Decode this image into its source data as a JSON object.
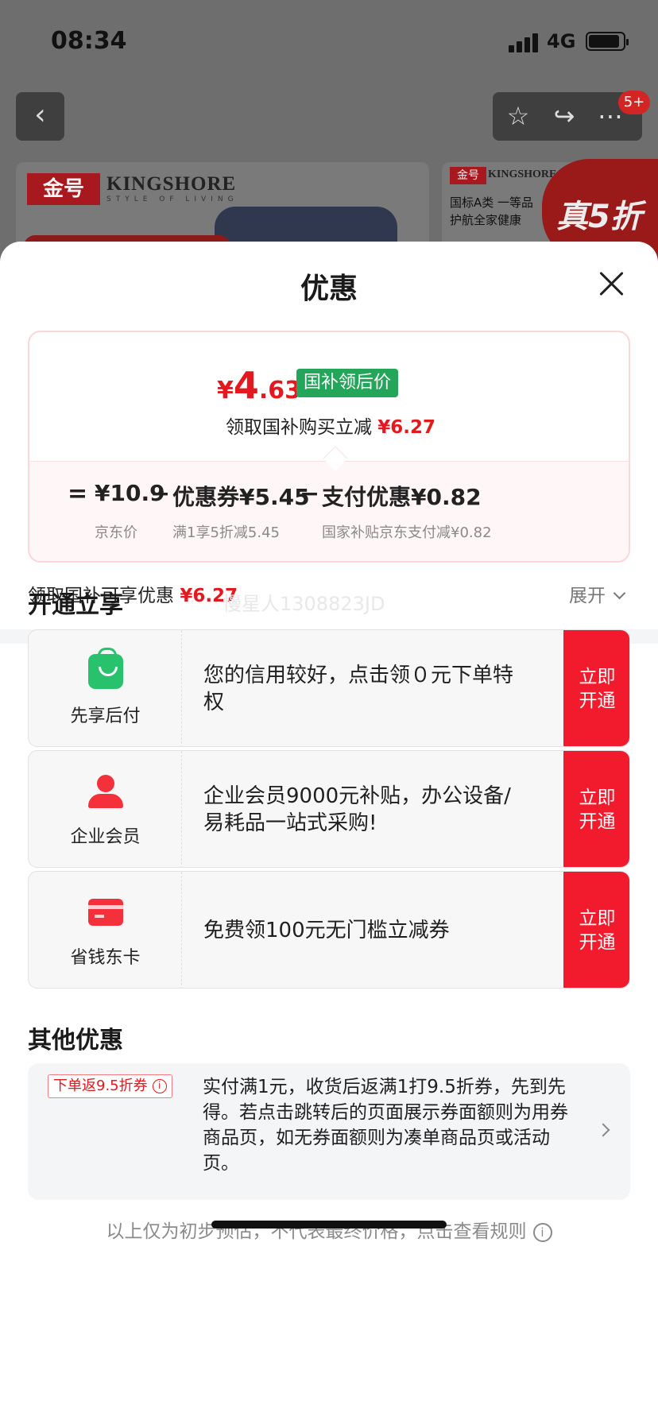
{
  "status_bar": {
    "time": "08:34",
    "network": "4G"
  },
  "background_page": {
    "notification_badge": "5+",
    "banner_left": {
      "brand_cn": "金号",
      "brand_en": "KINGSHORE",
      "brand_tagline": "STYLE OF LIVING"
    },
    "banner_right": {
      "brand_cn": "金号",
      "brand_en": "KINGSHORE",
      "line1": "国标A类 一等品",
      "line2": "护航全家健康",
      "sale": "真5折"
    }
  },
  "sheet": {
    "title": "优惠",
    "price_card": {
      "currency": "¥",
      "final_int": "4",
      "final_dec": ".63",
      "tag": "国补领后价",
      "save_text": "领取国补购买立减",
      "save_amount": "¥6.27",
      "calc": {
        "eq": "=",
        "item1_value": "¥10.9",
        "item1_sub": "京东价",
        "minus": "−",
        "item2_value": "优惠券¥5.45",
        "item2_sub": "满1享5折减5.45",
        "item3_value": "支付优惠¥0.82",
        "item3_sub": "国家补贴京东支付减¥0.82"
      }
    },
    "summary": {
      "text": "领取国补可享优惠",
      "amount": "¥6.27",
      "expand_label": "展开"
    },
    "open_section": {
      "title": "开通立享",
      "watermark": "慢星人1308823JD",
      "items": [
        {
          "icon": "shopping-bag-icon",
          "name": "先享后付",
          "desc": "您的信用较好，点击领０元下单特权",
          "button": "立即开通"
        },
        {
          "icon": "user-icon",
          "name": "企业会员",
          "desc": "企业会员9000元补贴，办公设备/易耗品一站式采购!",
          "button": "立即开通"
        },
        {
          "icon": "card-icon",
          "name": "省钱东卡",
          "desc": "免费领100元无门槛立减券",
          "button": "立即开通"
        }
      ]
    },
    "other_section": {
      "title": "其他优惠",
      "coupon_tag": "下单返9.5折券",
      "description": "实付满1元，收货后返满1打9.5折券，先到先得。若点击跳转后的页面展示券面额则为用券商品页，如无券面额则为凑单商品页或活动页。"
    },
    "footer_note": "以上仅为初步预估，不代表最终价格，点击查看规则"
  },
  "colors": {
    "accent_red": "#e3191f",
    "button_red": "#f21b2d",
    "tag_green": "#23a55a"
  }
}
